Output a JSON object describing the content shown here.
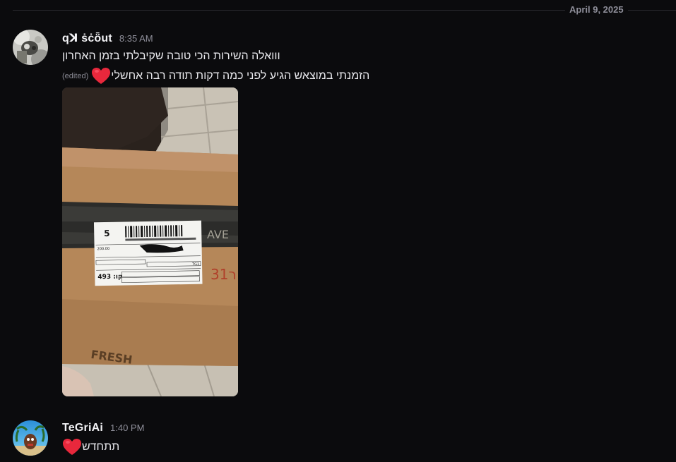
{
  "divider": {
    "date": "April 9, 2025"
  },
  "messages": [
    {
      "username": "qꓘ ṡċȫut",
      "time": "8:35 AM",
      "lines": [
        "ווואלה השירות הכי טובה שקיבלתי בזמן האחרון",
        "הזמנתי במוצאש הגיע לפני כמה דקות תודה רבה אחשלי"
      ],
      "edited": "(edited)",
      "attachment": {
        "label_number": "5",
        "label_code": "493 :קו",
        "label_price": "200.00",
        "label_id": "TG1",
        "box_text": "AVE",
        "box_marker": "ר31",
        "bottom_text": "FRESH"
      }
    },
    {
      "username": "TeGriAi",
      "time": "1:40 PM",
      "lines": [
        "תתחדש"
      ]
    }
  ],
  "icons": {
    "reaction": "heart-icon"
  },
  "colors": {
    "heart": "#e8283c",
    "background": "#0b0b0d"
  }
}
